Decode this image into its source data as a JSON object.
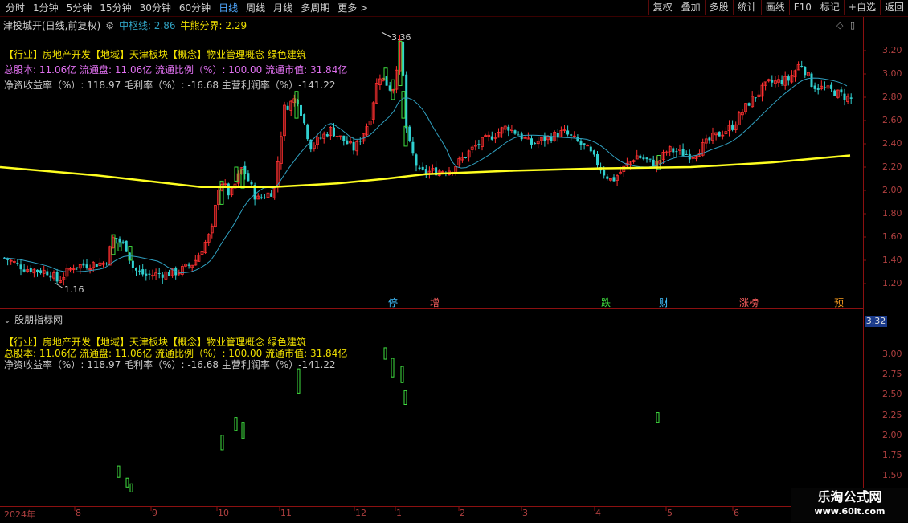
{
  "toolbar": {
    "periods": [
      "分时",
      "1分钟",
      "5分钟",
      "15分钟",
      "30分钟",
      "60分钟",
      "日线",
      "周线",
      "月线",
      "多周期",
      "更多 >"
    ],
    "active_period": "日线",
    "tools": [
      "复权",
      "叠加",
      "多股",
      "统计",
      "画线",
      "F10",
      "标记",
      "+自选",
      "返回"
    ]
  },
  "main": {
    "stock_title": "津投城开(日线,前复权)",
    "line1_label": "中枢线: 2.86",
    "line2_label": "牛熊分界: 2.29",
    "info_line1": "【行业】房地产开发【地域】天津板块【概念】物业管理概念 绿色建筑",
    "info_line2": "总股本: 11.06亿 流通盘: 11.06亿 流通比例（%）: 100.00 流通市值: 31.84亿",
    "info_line3": "净资收益率（%）: 118.97 毛利率（%）: -16.68 主营利润率（%）-141.22",
    "high_label": "3.36",
    "low_label": "1.16",
    "y_ticks": [
      "3.20",
      "3.00",
      "2.80",
      "2.60",
      "2.40",
      "2.20",
      "2.00",
      "1.80",
      "1.60",
      "1.40",
      "1.20"
    ],
    "events": [
      {
        "label": "停",
        "color": "#40c0ff"
      },
      {
        "label": "增",
        "color": "#ff6060"
      },
      {
        "label": "跌",
        "color": "#40e040"
      },
      {
        "label": "财",
        "color": "#40c0ff"
      },
      {
        "label": "涨榜",
        "color": "#ff6060"
      },
      {
        "label": "预",
        "color": "#ffa020"
      }
    ]
  },
  "sub": {
    "title": "股朋指标网",
    "info_line1": "【行业】房地产开发【地域】天津板块【概念】物业管理概念 绿色建筑",
    "info_line2": "总股本: 11.06亿 流通盘: 11.06亿 流通比例（%）: 100.00 流通市值: 31.84亿",
    "info_line3": "净资收益率（%）: 118.97 毛利率（%）: -16.68 主营利润率（%）-141.22",
    "price_tag": "3.32",
    "y_ticks": [
      "3.00",
      "2.75",
      "2.50",
      "2.25",
      "2.00",
      "1.75",
      "1.50"
    ]
  },
  "x_axis": [
    "2024年",
    "8",
    "9",
    "10",
    "11",
    "12",
    "1",
    "2",
    "3",
    "4",
    "5",
    "6"
  ],
  "watermark": {
    "title": "乐淘公式网",
    "url": "www.60lt.com"
  },
  "colors": {
    "up": "#ff3030",
    "down": "#30d0d0",
    "bull_bear_line": "#ffff20",
    "pivot_line": "#30a0c0"
  }
}
